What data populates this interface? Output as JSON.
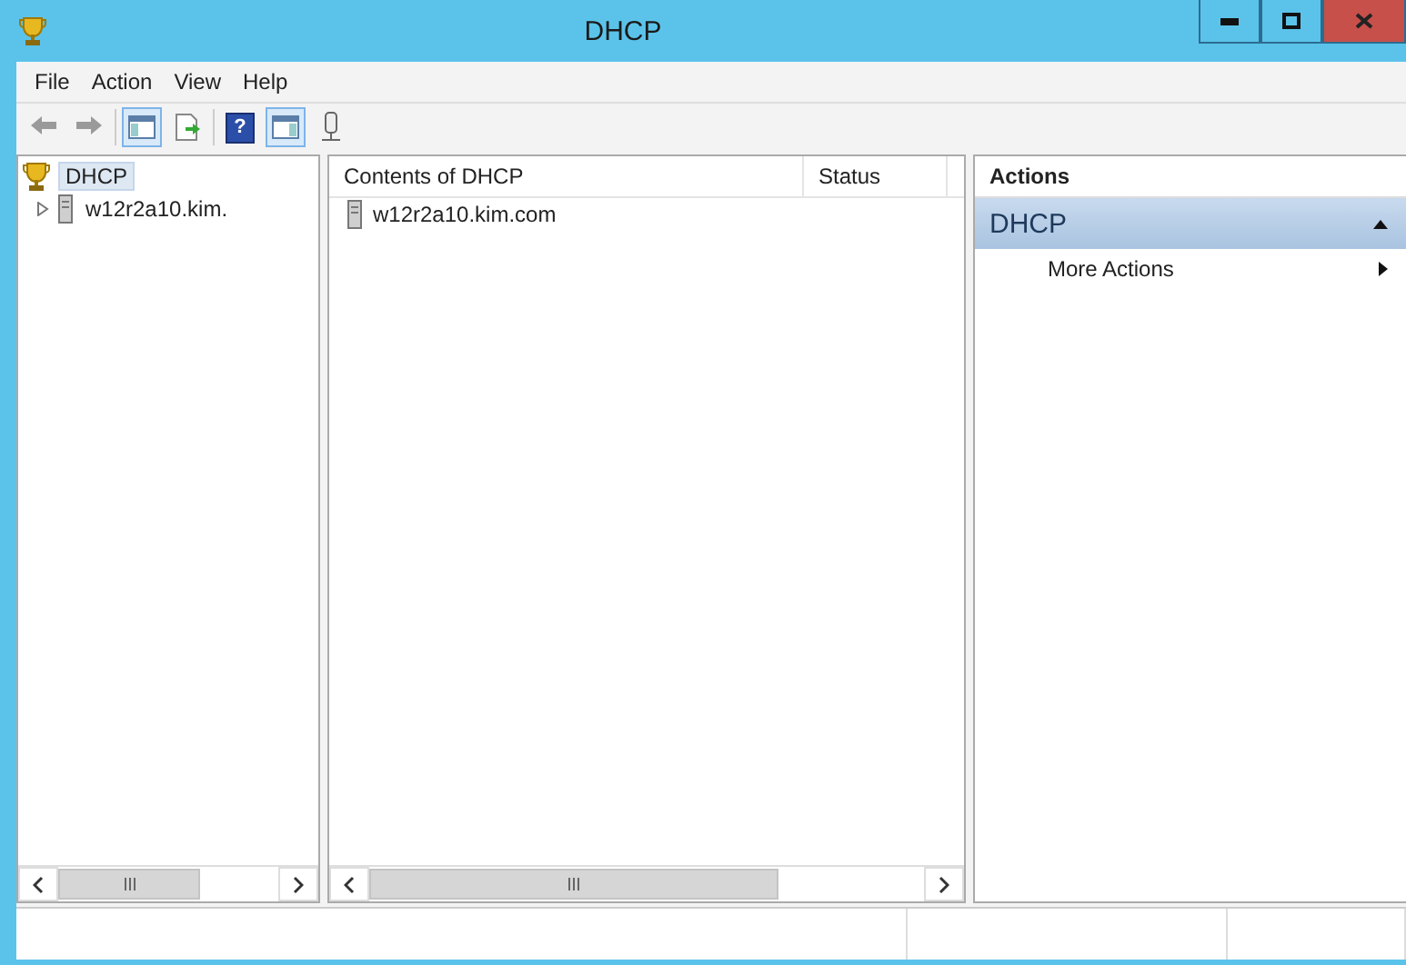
{
  "window": {
    "title": "DHCP"
  },
  "menu": [
    "File",
    "Action",
    "View",
    "Help"
  ],
  "toolbar": [
    [
      {
        "kind": "back",
        "selected": false
      },
      {
        "kind": "forward",
        "selected": false
      }
    ],
    [
      {
        "kind": "console-tree",
        "selected": true
      },
      {
        "kind": "export",
        "selected": false
      }
    ],
    [
      {
        "kind": "help",
        "glyph": "?",
        "selected": false
      },
      {
        "kind": "action-pane",
        "selected": true
      },
      {
        "kind": "server",
        "selected": false
      }
    ]
  ],
  "tree": [
    {
      "label": "DHCP",
      "selected": true,
      "children": [
        {
          "label": "w12r2a10.kim.",
          "selected": false,
          "expanded": false
        }
      ]
    }
  ],
  "list": {
    "columns": [
      "Contents of DHCP",
      "Status"
    ],
    "rows": [
      {
        "name": "w12r2a10.kim.com"
      }
    ]
  },
  "actions": {
    "title": "Actions",
    "sections": [
      {
        "label": "DHCP",
        "expanded": true,
        "items": [
          {
            "label": "More Actions"
          }
        ]
      }
    ]
  }
}
